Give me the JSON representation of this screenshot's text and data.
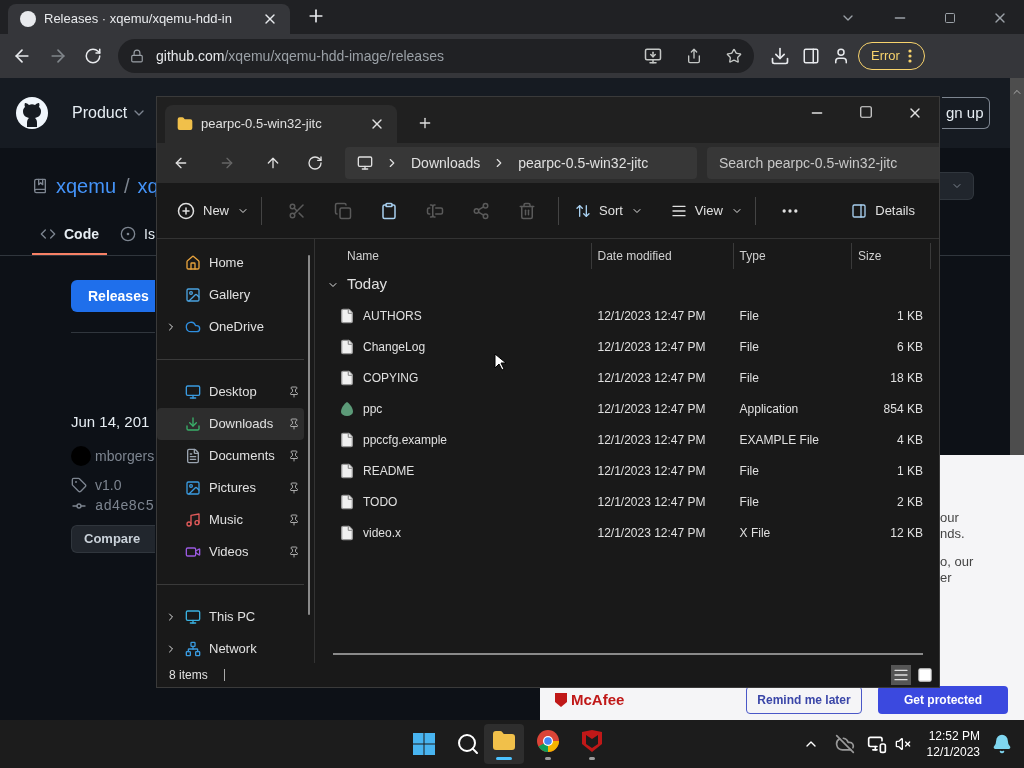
{
  "browser": {
    "tabs": [
      {
        "title": "Releases · xqemu/xqemu-hdd-in",
        "selected": true
      }
    ],
    "url_host": "github.com",
    "url_path": "/xqemu/xqemu-hdd-image/releases",
    "profile_button": "Error"
  },
  "github": {
    "nav_item": "Product",
    "owner": "xqemu",
    "separator": "/",
    "repo": "xq",
    "signup_button": "gn up",
    "tabs": [
      {
        "label": "Code",
        "selected": true
      },
      {
        "label": "Is",
        "selected": false
      }
    ],
    "releases_button": "Releases",
    "release": {
      "date": "Jun 14, 201",
      "author": "mborgers",
      "tag": "v1.0",
      "commit": "ad4e8c5",
      "compare_button": "Compare"
    }
  },
  "explorer": {
    "tabs": [
      {
        "title": "pearpc-0.5-win32-jitc",
        "selected": true
      }
    ],
    "breadcrumb": [
      "Downloads",
      "pearpc-0.5-win32-jitc"
    ],
    "search": {
      "placeholder": "Search pearpc-0.5-win32-jitc"
    },
    "toolbar": {
      "new": "New",
      "actions": [
        {
          "disabled": true
        },
        {
          "disabled": true
        },
        {
          "disabled": false
        },
        {
          "disabled": true
        },
        {
          "disabled": true
        },
        {
          "disabled": true
        }
      ],
      "sort": "Sort",
      "view": "View",
      "details": "Details"
    },
    "sidebar": [
      [
        {
          "label": "Home",
          "selected": false
        },
        {
          "label": "Gallery",
          "selected": false
        },
        {
          "label": "OneDrive",
          "selected": false,
          "expanded": false
        }
      ],
      [
        {
          "label": "Desktop",
          "selected": false,
          "pinned": true
        },
        {
          "label": "Downloads",
          "selected": true,
          "pinned": true
        },
        {
          "label": "Documents",
          "selected": false,
          "pinned": true
        },
        {
          "label": "Pictures",
          "selected": false,
          "pinned": true
        },
        {
          "label": "Music",
          "selected": false,
          "pinned": true
        },
        {
          "label": "Videos",
          "selected": false,
          "pinned": true
        }
      ],
      [
        {
          "label": "This PC",
          "selected": false,
          "expanded": false
        },
        {
          "label": "Network",
          "selected": false,
          "expanded": false
        }
      ]
    ],
    "columns": [
      "Name",
      "Date modified",
      "Type",
      "Size"
    ],
    "group": {
      "label": "Today",
      "expanded": true
    },
    "files": [
      {
        "name": "AUTHORS",
        "date": "12/1/2023 12:47 PM",
        "type": "File",
        "size": "1 KB",
        "kind": "file"
      },
      {
        "name": "ChangeLog",
        "date": "12/1/2023 12:47 PM",
        "type": "File",
        "size": "6 KB",
        "kind": "file"
      },
      {
        "name": "COPYING",
        "date": "12/1/2023 12:47 PM",
        "type": "File",
        "size": "18 KB",
        "kind": "file"
      },
      {
        "name": "ppc",
        "date": "12/1/2023 12:47 PM",
        "type": "Application",
        "size": "854 KB",
        "kind": "app"
      },
      {
        "name": "ppccfg.example",
        "date": "12/1/2023 12:47 PM",
        "type": "EXAMPLE File",
        "size": "4 KB",
        "kind": "file"
      },
      {
        "name": "README",
        "date": "12/1/2023 12:47 PM",
        "type": "File",
        "size": "1 KB",
        "kind": "file"
      },
      {
        "name": "TODO",
        "date": "12/1/2023 12:47 PM",
        "type": "File",
        "size": "2 KB",
        "kind": "file"
      },
      {
        "name": "video.x",
        "date": "12/1/2023 12:47 PM",
        "type": "X File",
        "size": "12 KB",
        "kind": "file"
      }
    ],
    "status": "8 items",
    "view_modes": [
      {
        "selected": true
      },
      {
        "selected": false
      }
    ]
  },
  "mcafee": {
    "logo": "McAfee",
    "text_lines": [
      "our",
      "nds.",
      "o, our",
      "er"
    ],
    "buttons": [
      "Remind me later",
      "Get protected"
    ]
  },
  "taskbar": {
    "apps": [
      {
        "kind": "explorer",
        "selected": true
      },
      {
        "kind": "chrome",
        "selected": false
      },
      {
        "kind": "mcafee",
        "selected": false
      }
    ],
    "time": "12:52 PM",
    "date": "12/1/2023"
  }
}
